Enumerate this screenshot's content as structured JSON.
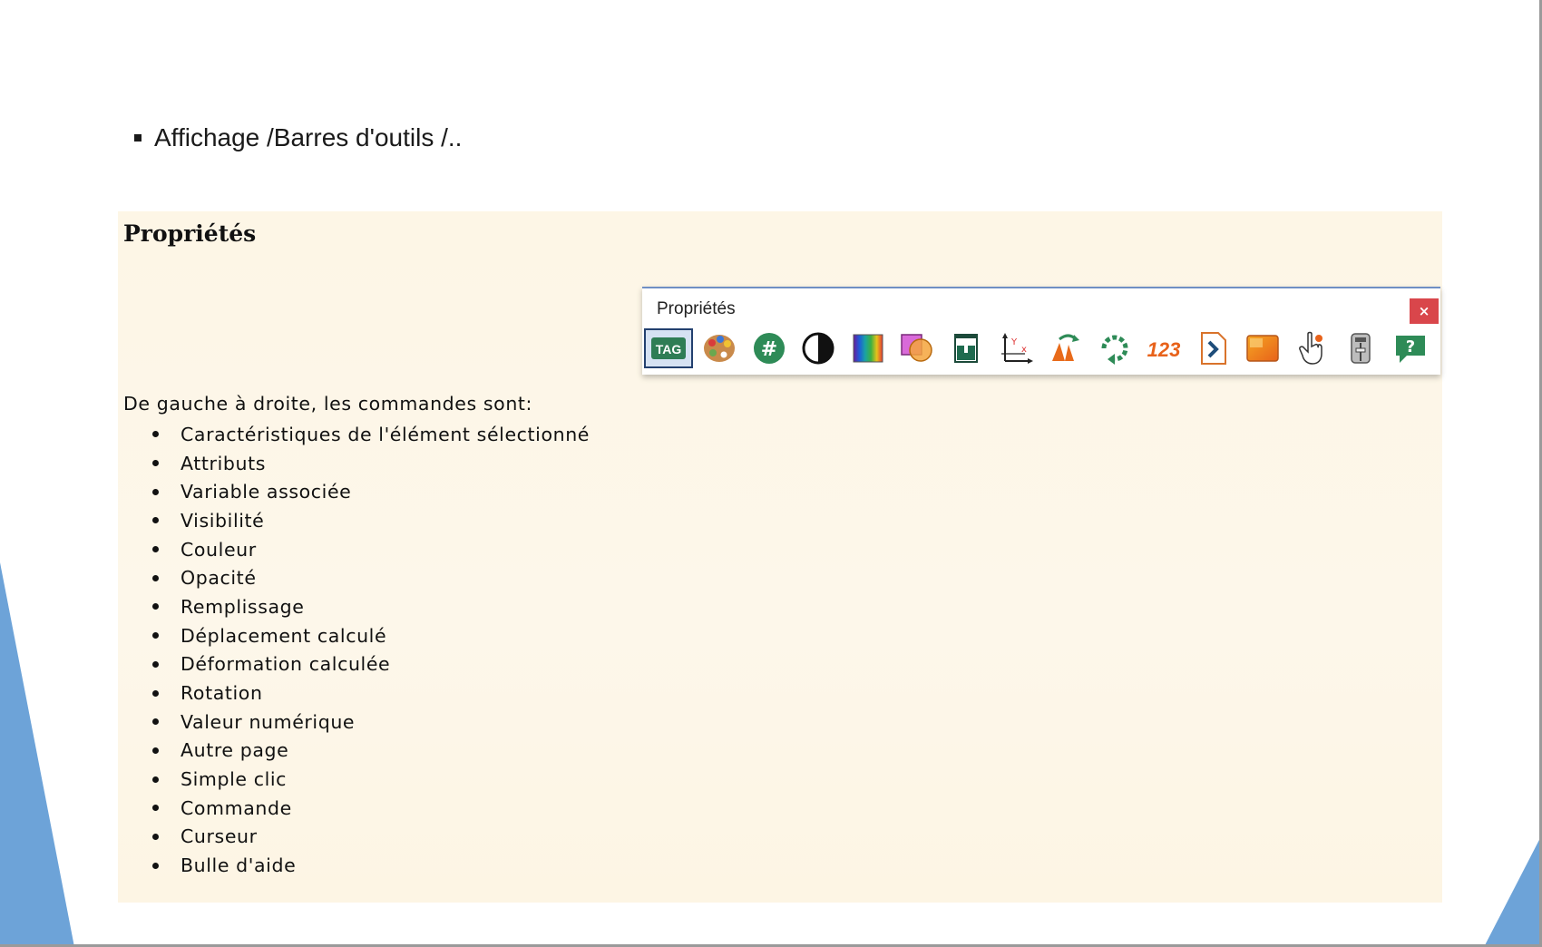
{
  "slide": {
    "bullet_text": "Affichage /Barres d'outils /.."
  },
  "panel": {
    "title": "Propriétés",
    "toolbar": {
      "title": "Propriétés",
      "close_label": "×",
      "tools": [
        {
          "icon": "tag-icon",
          "label": "TAG"
        },
        {
          "icon": "palette-icon"
        },
        {
          "icon": "hash-icon",
          "label": "#"
        },
        {
          "icon": "half-circle-icon"
        },
        {
          "icon": "color-spectrum-icon"
        },
        {
          "icon": "overlap-shapes-icon"
        },
        {
          "icon": "fill-up-icon"
        },
        {
          "icon": "move-axes-icon"
        },
        {
          "icon": "deform-icon"
        },
        {
          "icon": "rotate-icon"
        },
        {
          "icon": "numeric-icon",
          "label": "123"
        },
        {
          "icon": "page-arrow-icon"
        },
        {
          "icon": "click-orange-icon"
        },
        {
          "icon": "hand-cursor-icon"
        },
        {
          "icon": "cursor-slider-icon"
        },
        {
          "icon": "help-bubble-icon",
          "label": "?"
        }
      ]
    },
    "description": "De gauche à droite, les commandes sont:",
    "commands": [
      "Caractéristiques de l'élément sélectionné",
      "Attributs",
      "Variable associée",
      "Visibilité",
      "Couleur",
      "Opacité",
      "Remplissage",
      "Déplacement calculé",
      "Déformation calculée",
      "Rotation",
      "Valeur numérique",
      "Autre page",
      "Simple clic",
      "Commande",
      "Curseur",
      "Bulle d'aide"
    ]
  },
  "colors": {
    "panel_bg": "#fdf6e6",
    "close_bg": "#d9464b",
    "deco_blue": "#5b9bd5",
    "selected_border": "#23406f"
  }
}
